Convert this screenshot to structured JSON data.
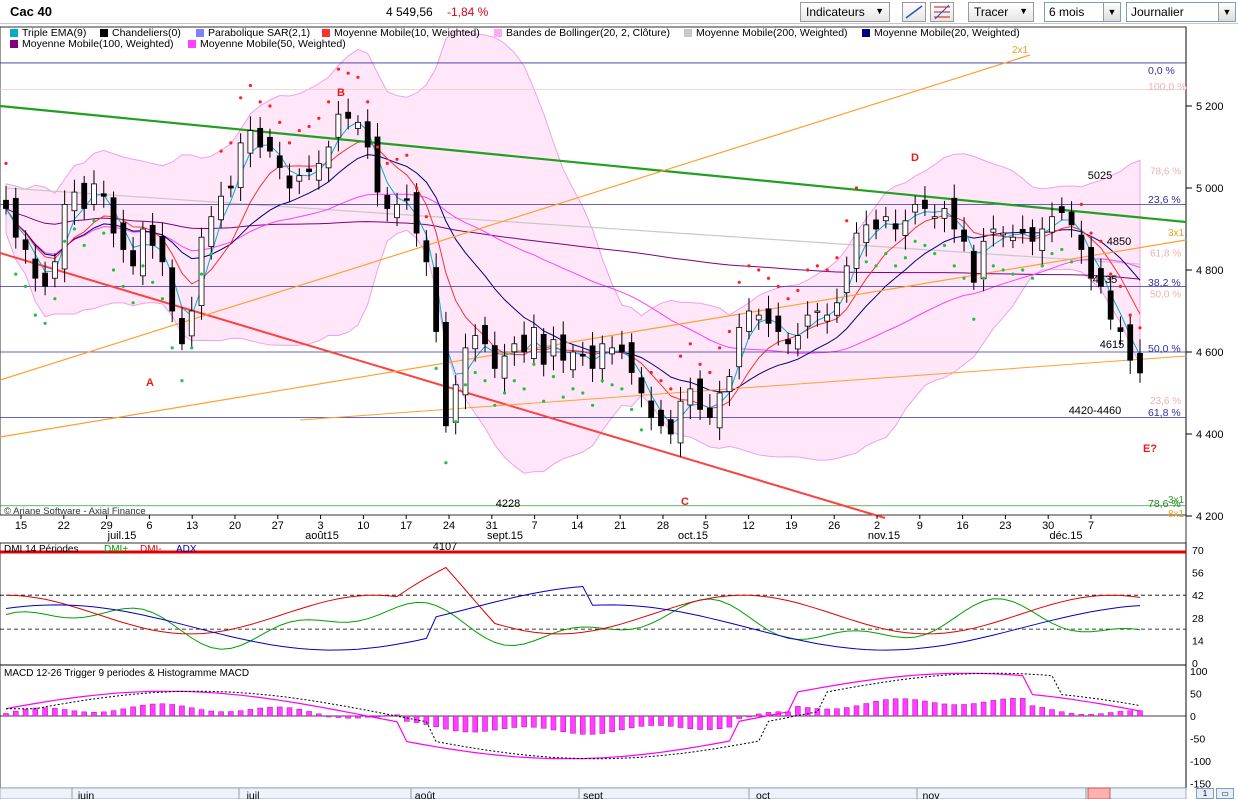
{
  "header": {
    "title": "Cac 40",
    "price": "4 549,56",
    "change": "-1,84 %",
    "indicators_button": "Indicateurs",
    "draw_button": "Tracer",
    "period_select": "6 mois",
    "interval_select": "Journalier"
  },
  "legend": [
    {
      "label": "Triple EMA(9)",
      "color": "#00b0c8"
    },
    {
      "label": "Chandeliers(0)",
      "color": "#000000"
    },
    {
      "label": "Parabolique SAR(2,1)",
      "color": "#8080ff"
    },
    {
      "label": "Moyenne Mobile(10, Weighted)",
      "color": "#ff3030"
    },
    {
      "label": "Bandes de Bollinger(20, 2, Clôture)",
      "color": "#ffaaee"
    },
    {
      "label": "Moyenne Mobile(200, Weighted)",
      "color": "#c8c8c8"
    },
    {
      "label": "Moyenne Mobile(20, Weighted)",
      "color": "#000080"
    },
    {
      "label": "Moyenne Mobile(100, Weighted)",
      "color": "#800080"
    },
    {
      "label": "Moyenne Mobile(50, Weighted)",
      "color": "#ff40ff"
    }
  ],
  "chart_data": {
    "type": "candlestick",
    "yaxis_ticks": [
      "5 200",
      "5 000",
      "4 800",
      "4 600",
      "4 400",
      "4 200"
    ],
    "xaxis_ticks": [
      "15",
      "22",
      "29",
      "6",
      "13",
      "20",
      "27",
      "3",
      "10",
      "17",
      "24",
      "31",
      "7",
      "14",
      "21",
      "28",
      "5",
      "12",
      "19",
      "26",
      "2",
      "9",
      "16",
      "23",
      "30",
      "7"
    ],
    "month_labels": [
      "juil.15",
      "août15",
      "sept.15",
      "oct.15",
      "nov.15",
      "déc.15"
    ],
    "fib_labels": [
      "0,0 %",
      "23,6 %",
      "38,2 %",
      "50,0 %",
      "61,8 %",
      "78,6 %",
      "100,0 %"
    ],
    "annotations": [
      "A",
      "B",
      "C",
      "D",
      "E?",
      "5025",
      "4850",
      "4735",
      "4615",
      "4420-4460",
      "4228",
      "4107",
      "2x1",
      "3x1",
      "3x1",
      "8x1"
    ],
    "candles_close": [
      4950,
      4880,
      4850,
      4780,
      4760,
      4820,
      4960,
      4990,
      4950,
      5010,
      4980,
      4890,
      4850,
      4810,
      4900,
      4860,
      4820,
      4700,
      4620,
      4700,
      4880,
      4930,
      4980,
      5000,
      5110,
      5140,
      5100,
      5090,
      5050,
      5000,
      5030,
      5040,
      5060,
      5100,
      5180,
      5170,
      5160,
      5100,
      4990,
      4950,
      4960,
      4970,
      4890,
      4820,
      4650,
      4420,
      4520,
      4610,
      4640,
      4620,
      4560,
      4590,
      4620,
      4600,
      4660,
      4570,
      4630,
      4580,
      4600,
      4590,
      4560,
      4620,
      4610,
      4600,
      4550,
      4500,
      4440,
      4420,
      4400,
      4480,
      4510,
      4460,
      4440,
      4500,
      4540,
      4660,
      4700,
      4690,
      4670,
      4650,
      4620,
      4640,
      4690,
      4700,
      4690,
      4720,
      4810,
      4890,
      4910,
      4900,
      4930,
      4900,
      4920,
      4960,
      4950,
      4930,
      4950,
      4900,
      4870,
      4770,
      4870,
      4900,
      4890,
      4880,
      4890,
      4870,
      4900,
      4930,
      4940,
      4910,
      4850,
      4780,
      4760,
      4680,
      4650,
      4580,
      4549
    ],
    "dmi": {
      "title": "DMI 14 Périodes",
      "series": [
        "DMI+",
        "DMI-",
        "ADX"
      ],
      "yticks": [
        "70",
        "56",
        "42",
        "28",
        "14",
        "0"
      ]
    },
    "macd": {
      "title": "MACD 12-26   Trigger 9 periodes & Histogramme MACD",
      "yticks": [
        "100",
        "50",
        "0",
        "-50",
        "-100",
        "-150"
      ]
    },
    "overview_months": [
      "juin",
      "juil",
      "août",
      "sept",
      "oct",
      "nov",
      "déc"
    ],
    "footer_text": "© Ariane Software - Axial Finance"
  }
}
